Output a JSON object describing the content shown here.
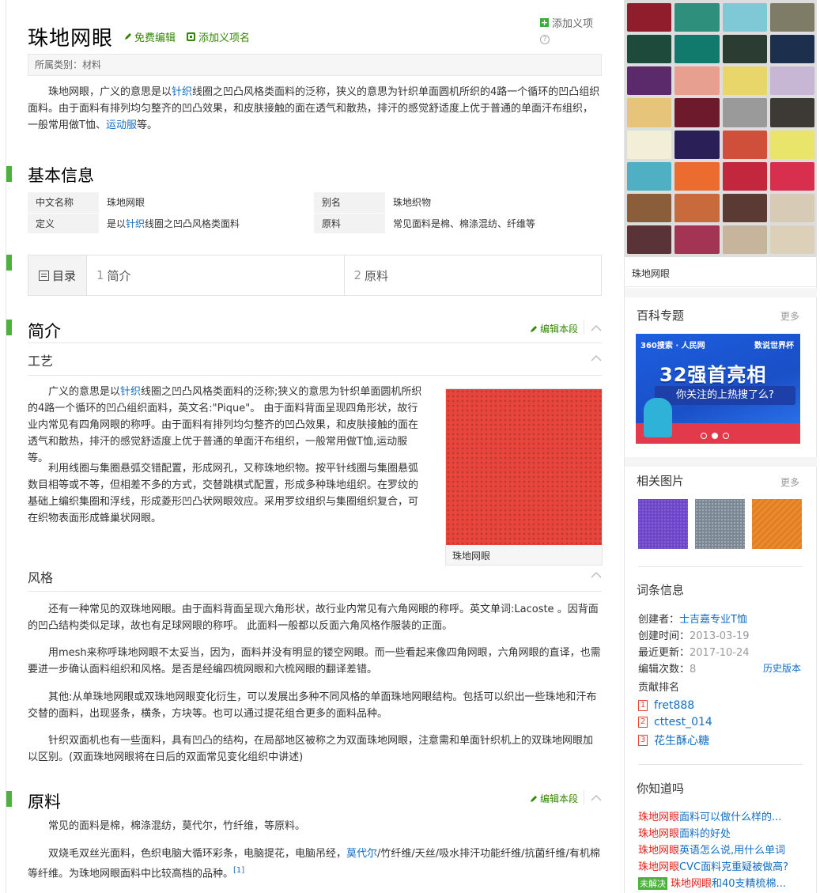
{
  "title": "珠地网眼",
  "title_actions": {
    "free_edit": "免费编辑",
    "add_sense": "添加义项名"
  },
  "top_right": {
    "add_item": "添加义项",
    "help": "?"
  },
  "category": "所属类别：材料",
  "lead": {
    "p1_pre": "珠地网眼，广义的意思是以",
    "p1_link": "针织",
    "p1_post": "线圈之凹凸风格类面料的泛称，狭义的意思为针织单面圆机所织的4路一个循环的凹凸组织面料。由于面料有排列均匀整齐的凹凸效果，和皮肤接触的面在透气和散热，排汗的感觉舒适度上优于普通的单面汗布组织，一般常用做T恤、",
    "p1_link2": "运动服",
    "p1_end": "等。"
  },
  "basic": {
    "heading": "基本信息",
    "rows": [
      {
        "k1": "中文名称",
        "v1": "珠地网眼",
        "k2": "别名",
        "v2": "珠地织物"
      },
      {
        "k1": "定义",
        "v1_pre": "是以",
        "v1_link": "针织",
        "v1_post": "线圈之凹凸风格类面料",
        "k2": "原料",
        "v2": "常见面料是棉、棉涤混纺、纤维等"
      }
    ]
  },
  "toc": {
    "head": "目录",
    "items": [
      {
        "num": "1",
        "label": "简介"
      },
      {
        "num": "2",
        "label": "原料"
      }
    ]
  },
  "intro": {
    "heading": "简介",
    "edit": "编辑本段",
    "craft": {
      "heading": "工艺",
      "p1_pre": "广义的意思是以",
      "p1_link": "针织",
      "p1_post": "线圈之凹凸风格类面料的泛称;狭义的意思为针织单面圆机所织的4路一个循环的凹凸组织面料，英文名:\"Pique\"。 由于面料背面呈现四角形状，故行业内常见有四角网眼的称呼。由于面料有排列均匀整齐的凹凸效果，和皮肤接触的面在透气和散热，排汗的感觉舒适度上优于普通的单面汗布组织，一般常用做T恤,运动服等。",
      "p2": "利用线圈与集圈悬弧交错配置，形成网孔，又称珠地织物。按平针线圈与集圈悬弧数目相等或不等，但相差不多的方式，交替跳棋式配置，形成多种珠地组织。在罗纹的基础上编织集圈和浮线，形成菱形凹凸状网眼效应。采用罗纹组织与集圈组织复合，可在织物表面形成蜂巢状网眼。",
      "image_caption": "珠地网眼"
    },
    "style": {
      "heading": "风格",
      "p1": "还有一种常见的双珠地网眼。由于面料背面呈现六角形状，故行业内常见有六角网眼的称呼。英文单词:Lacoste 。因背面的凹凸结构类似足球，故也有足球网眼的称呼。 此面料一般都以反面六角风格作服装的正面。",
      "p2": "用mesh来称呼珠地网眼不太妥当，因为，面料并没有明显的镂空网眼。而一些看起来像四角网眼，六角网眼的直译，也需要进一步确认面料组织和风格。是否是经编四梳网眼和六梳网眼的翻译差错。",
      "p3": "其他:从单珠地网眼或双珠地网眼变化衍生，可以发展出多种不同风格的单面珠地网眼结构。包括可以织出一些珠地和汗布交替的面料，出现竖条，横条，方块等。也可以通过提花组合更多的面料品种。",
      "p4": "针织双面机也有一些面料，具有凹凸的结构，在局部地区被称之为双面珠地网眼，注意需和单面针织机上的双珠地网眼加以区别。(双面珠地网眼将在日后的双面常见变化组织中讲述)"
    }
  },
  "material": {
    "heading": "原料",
    "edit": "编辑本段",
    "p1": "常见的面料是棉，棉涤混纺，莫代尔，竹纤维，等原料。",
    "p2_pre": "双烧毛双丝光面料，色织电脑大循环彩条，电脑提花，电脑吊经，",
    "p2_link": "莫代尔",
    "p2_post": "/竹纤维/天丝/吸水排汗功能纤维/抗菌纤维/有机棉等纤维。为珠地网眼面料中比较高档的品种。",
    "ref": "[1]"
  },
  "sidebar": {
    "main_caption": "珠地网眼",
    "topics": {
      "heading": "百科专题",
      "more": "更多",
      "banner_brand1": "360搜索",
      "banner_brand2": "人民网",
      "banner_right": "数说世界杯",
      "banner_big": "32强首亮相",
      "banner_sub": "你关注的上热搜了么?"
    },
    "related": {
      "heading": "相关图片",
      "more": "更多"
    },
    "entry": {
      "heading": "词条信息",
      "creator_label": "创建者：",
      "creator": "士吉嘉专业T恤",
      "created_label": "创建时间：",
      "created": "2013-03-19",
      "updated_label": "最近更新：",
      "updated": "2017-10-24",
      "edits_label": "编辑次数：",
      "edits": "8",
      "history": "历史版本",
      "ranking_label": "贡献排名",
      "ranking": [
        {
          "n": "1",
          "name": "fret888"
        },
        {
          "n": "2",
          "name": "cttest_014"
        },
        {
          "n": "3",
          "name": "花生酥心糖"
        }
      ]
    },
    "know": {
      "heading": "你知道吗",
      "items": [
        {
          "red": "珠地网眼",
          "blue": "面料可以做什么样的..."
        },
        {
          "red": "珠地网眼",
          "blue": "面料的好处"
        },
        {
          "red": "珠地网眼",
          "blue": "英语怎么说,用什么单词"
        },
        {
          "red": "珠地网眼",
          "blue": "CVC面料克重疑被做高?"
        }
      ],
      "last_badge": "未解决",
      "last_red": "珠地网眼",
      "last_blue": "和40支精梳棉..."
    }
  },
  "colors": {
    "accent_green": "#4bb33c",
    "link_blue": "#136ec2",
    "hot_red": "#e3231f"
  }
}
